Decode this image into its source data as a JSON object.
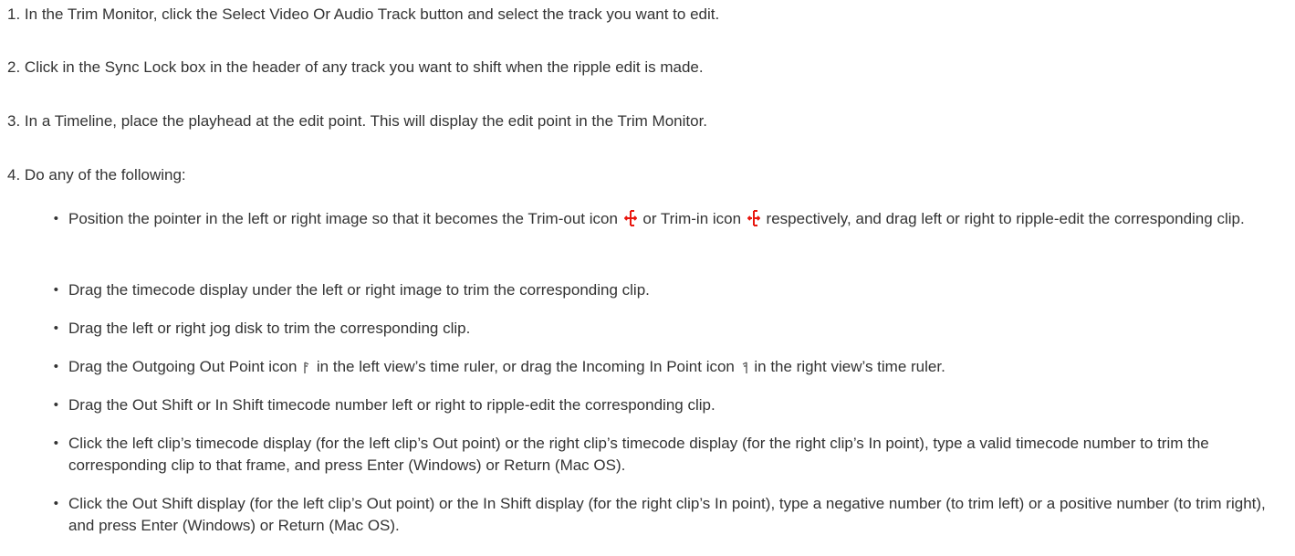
{
  "steps": [
    {
      "num": "1.",
      "text": "In the Trim Monitor, click the Select Video Or Audio Track button and select the track you want to edit."
    },
    {
      "num": "2.",
      "text": "Click in the Sync Lock box in the header of any track you want to shift when the ripple edit is made."
    },
    {
      "num": "3.",
      "text": "In a Timeline, place the playhead at the edit point. This will display the edit point in the Trim Monitor."
    },
    {
      "num": "4.",
      "text": "Do any of the following:"
    }
  ],
  "bullets": [
    {
      "part1": "Position the pointer in the left or right image so that it becomes the Trim-out icon",
      "part2": "or Trim-in icon",
      "part3": "respectively, and drag left or right to ripple-edit the corresponding clip."
    },
    {
      "text": "Drag the timecode display under the left or right image to trim the corresponding clip."
    },
    {
      "text": "Drag the left or right jog disk to trim the corresponding clip."
    },
    {
      "part1": "Drag the Outgoing Out Point icon",
      "part2": "in the left view’s time ruler, or drag the Incoming In Point icon",
      "part3": "in the right view’s time ruler."
    },
    {
      "text": "Drag the Out Shift or In Shift timecode number left or right to ripple-edit the corresponding clip."
    },
    {
      "text": "Click the left clip’s timecode display (for the left clip’s Out point) or the right clip’s timecode display (for the right clip’s In point), type a valid timecode number to trim the corresponding clip to that frame, and press Enter (Windows) or Return (Mac OS)."
    },
    {
      "text": "Click the Out Shift display (for the left clip’s Out point) or the In Shift display (for the right clip’s In point), type a negative number (to trim left) or a positive number (to trim right), and press Enter (Windows) or Return (Mac OS)."
    }
  ],
  "bullet_symbol": "•",
  "icons": {
    "trim_out": "trim-out-icon",
    "trim_in": "trim-in-icon",
    "outgoing_out_point": "outgoing-out-point-icon",
    "incoming_in_point": "incoming-in-point-icon"
  },
  "colors": {
    "text": "#333333",
    "trim_icon": "#e8170f",
    "marker_icon": "#666666"
  }
}
